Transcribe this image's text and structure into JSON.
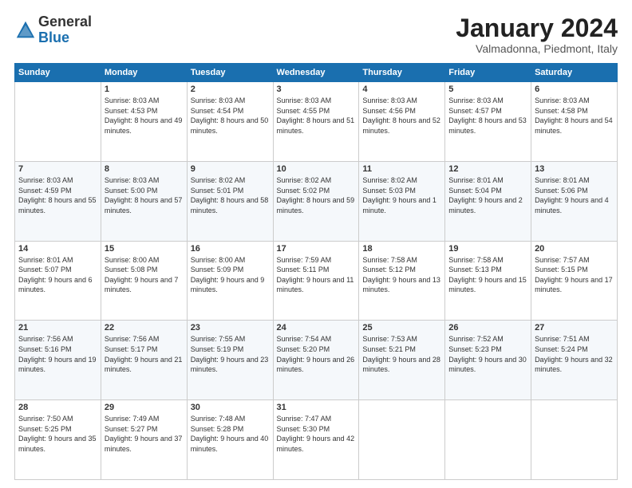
{
  "header": {
    "logo": {
      "general": "General",
      "blue": "Blue"
    },
    "month": "January 2024",
    "location": "Valmadonna, Piedmont, Italy"
  },
  "weekdays": [
    "Sunday",
    "Monday",
    "Tuesday",
    "Wednesday",
    "Thursday",
    "Friday",
    "Saturday"
  ],
  "weeks": [
    [
      {
        "day": null,
        "sunrise": null,
        "sunset": null,
        "daylight": null
      },
      {
        "day": "1",
        "sunrise": "Sunrise: 8:03 AM",
        "sunset": "Sunset: 4:53 PM",
        "daylight": "Daylight: 8 hours and 49 minutes."
      },
      {
        "day": "2",
        "sunrise": "Sunrise: 8:03 AM",
        "sunset": "Sunset: 4:54 PM",
        "daylight": "Daylight: 8 hours and 50 minutes."
      },
      {
        "day": "3",
        "sunrise": "Sunrise: 8:03 AM",
        "sunset": "Sunset: 4:55 PM",
        "daylight": "Daylight: 8 hours and 51 minutes."
      },
      {
        "day": "4",
        "sunrise": "Sunrise: 8:03 AM",
        "sunset": "Sunset: 4:56 PM",
        "daylight": "Daylight: 8 hours and 52 minutes."
      },
      {
        "day": "5",
        "sunrise": "Sunrise: 8:03 AM",
        "sunset": "Sunset: 4:57 PM",
        "daylight": "Daylight: 8 hours and 53 minutes."
      },
      {
        "day": "6",
        "sunrise": "Sunrise: 8:03 AM",
        "sunset": "Sunset: 4:58 PM",
        "daylight": "Daylight: 8 hours and 54 minutes."
      }
    ],
    [
      {
        "day": "7",
        "sunrise": "Sunrise: 8:03 AM",
        "sunset": "Sunset: 4:59 PM",
        "daylight": "Daylight: 8 hours and 55 minutes."
      },
      {
        "day": "8",
        "sunrise": "Sunrise: 8:03 AM",
        "sunset": "Sunset: 5:00 PM",
        "daylight": "Daylight: 8 hours and 57 minutes."
      },
      {
        "day": "9",
        "sunrise": "Sunrise: 8:02 AM",
        "sunset": "Sunset: 5:01 PM",
        "daylight": "Daylight: 8 hours and 58 minutes."
      },
      {
        "day": "10",
        "sunrise": "Sunrise: 8:02 AM",
        "sunset": "Sunset: 5:02 PM",
        "daylight": "Daylight: 8 hours and 59 minutes."
      },
      {
        "day": "11",
        "sunrise": "Sunrise: 8:02 AM",
        "sunset": "Sunset: 5:03 PM",
        "daylight": "Daylight: 9 hours and 1 minute."
      },
      {
        "day": "12",
        "sunrise": "Sunrise: 8:01 AM",
        "sunset": "Sunset: 5:04 PM",
        "daylight": "Daylight: 9 hours and 2 minutes."
      },
      {
        "day": "13",
        "sunrise": "Sunrise: 8:01 AM",
        "sunset": "Sunset: 5:06 PM",
        "daylight": "Daylight: 9 hours and 4 minutes."
      }
    ],
    [
      {
        "day": "14",
        "sunrise": "Sunrise: 8:01 AM",
        "sunset": "Sunset: 5:07 PM",
        "daylight": "Daylight: 9 hours and 6 minutes."
      },
      {
        "day": "15",
        "sunrise": "Sunrise: 8:00 AM",
        "sunset": "Sunset: 5:08 PM",
        "daylight": "Daylight: 9 hours and 7 minutes."
      },
      {
        "day": "16",
        "sunrise": "Sunrise: 8:00 AM",
        "sunset": "Sunset: 5:09 PM",
        "daylight": "Daylight: 9 hours and 9 minutes."
      },
      {
        "day": "17",
        "sunrise": "Sunrise: 7:59 AM",
        "sunset": "Sunset: 5:11 PM",
        "daylight": "Daylight: 9 hours and 11 minutes."
      },
      {
        "day": "18",
        "sunrise": "Sunrise: 7:58 AM",
        "sunset": "Sunset: 5:12 PM",
        "daylight": "Daylight: 9 hours and 13 minutes."
      },
      {
        "day": "19",
        "sunrise": "Sunrise: 7:58 AM",
        "sunset": "Sunset: 5:13 PM",
        "daylight": "Daylight: 9 hours and 15 minutes."
      },
      {
        "day": "20",
        "sunrise": "Sunrise: 7:57 AM",
        "sunset": "Sunset: 5:15 PM",
        "daylight": "Daylight: 9 hours and 17 minutes."
      }
    ],
    [
      {
        "day": "21",
        "sunrise": "Sunrise: 7:56 AM",
        "sunset": "Sunset: 5:16 PM",
        "daylight": "Daylight: 9 hours and 19 minutes."
      },
      {
        "day": "22",
        "sunrise": "Sunrise: 7:56 AM",
        "sunset": "Sunset: 5:17 PM",
        "daylight": "Daylight: 9 hours and 21 minutes."
      },
      {
        "day": "23",
        "sunrise": "Sunrise: 7:55 AM",
        "sunset": "Sunset: 5:19 PM",
        "daylight": "Daylight: 9 hours and 23 minutes."
      },
      {
        "day": "24",
        "sunrise": "Sunrise: 7:54 AM",
        "sunset": "Sunset: 5:20 PM",
        "daylight": "Daylight: 9 hours and 26 minutes."
      },
      {
        "day": "25",
        "sunrise": "Sunrise: 7:53 AM",
        "sunset": "Sunset: 5:21 PM",
        "daylight": "Daylight: 9 hours and 28 minutes."
      },
      {
        "day": "26",
        "sunrise": "Sunrise: 7:52 AM",
        "sunset": "Sunset: 5:23 PM",
        "daylight": "Daylight: 9 hours and 30 minutes."
      },
      {
        "day": "27",
        "sunrise": "Sunrise: 7:51 AM",
        "sunset": "Sunset: 5:24 PM",
        "daylight": "Daylight: 9 hours and 32 minutes."
      }
    ],
    [
      {
        "day": "28",
        "sunrise": "Sunrise: 7:50 AM",
        "sunset": "Sunset: 5:25 PM",
        "daylight": "Daylight: 9 hours and 35 minutes."
      },
      {
        "day": "29",
        "sunrise": "Sunrise: 7:49 AM",
        "sunset": "Sunset: 5:27 PM",
        "daylight": "Daylight: 9 hours and 37 minutes."
      },
      {
        "day": "30",
        "sunrise": "Sunrise: 7:48 AM",
        "sunset": "Sunset: 5:28 PM",
        "daylight": "Daylight: 9 hours and 40 minutes."
      },
      {
        "day": "31",
        "sunrise": "Sunrise: 7:47 AM",
        "sunset": "Sunset: 5:30 PM",
        "daylight": "Daylight: 9 hours and 42 minutes."
      },
      {
        "day": null,
        "sunrise": null,
        "sunset": null,
        "daylight": null
      },
      {
        "day": null,
        "sunrise": null,
        "sunset": null,
        "daylight": null
      },
      {
        "day": null,
        "sunrise": null,
        "sunset": null,
        "daylight": null
      }
    ]
  ]
}
